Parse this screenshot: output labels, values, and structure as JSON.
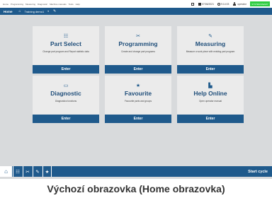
{
  "menubar": {
    "items": [
      "Home",
      "Programming",
      "Measuring",
      "Diagnostic",
      "Machine manuals",
      "Tools",
      "Help"
    ],
    "date": "07/06/2021",
    "time": "9:14:03",
    "user": "operator",
    "status": "SYSTEM READY"
  },
  "navbar": {
    "home": "Home",
    "training": "Training demo1",
    "dropdown_icon": "chevron-down-icon",
    "edit_icon": "pencil-icon"
  },
  "tiles": [
    {
      "title": "Part Select",
      "desc": "Change part program and Report statistic data",
      "enter": "Enter",
      "icon": "list-icon"
    },
    {
      "title": "Programming",
      "desc": "Create and change part programs",
      "enter": "Enter",
      "icon": "tools-icon"
    },
    {
      "title": "Measuring",
      "desc": "Measure a work piece with existing part program",
      "enter": "Enter",
      "icon": "probe-icon"
    },
    {
      "title": "Diagnostic",
      "desc": "Diagnostics functions",
      "enter": "Enter",
      "icon": "monitor-icon"
    },
    {
      "title": "Favourite",
      "desc": "Favourite parts and groups",
      "enter": "Enter",
      "icon": "star-icon"
    },
    {
      "title": "Help Online",
      "desc": "Open operator manual",
      "enter": "Enter",
      "icon": "book-icon"
    }
  ],
  "bottombar": {
    "start_cycle": "Start cycle"
  },
  "caption": "Výchozí obrazovka (Home obrazovka)",
  "colors": {
    "primary": "#1f5a8c",
    "status_green": "#2ecc40",
    "tile_bg": "#ebebeb",
    "screen_bg": "#d8dadc"
  }
}
